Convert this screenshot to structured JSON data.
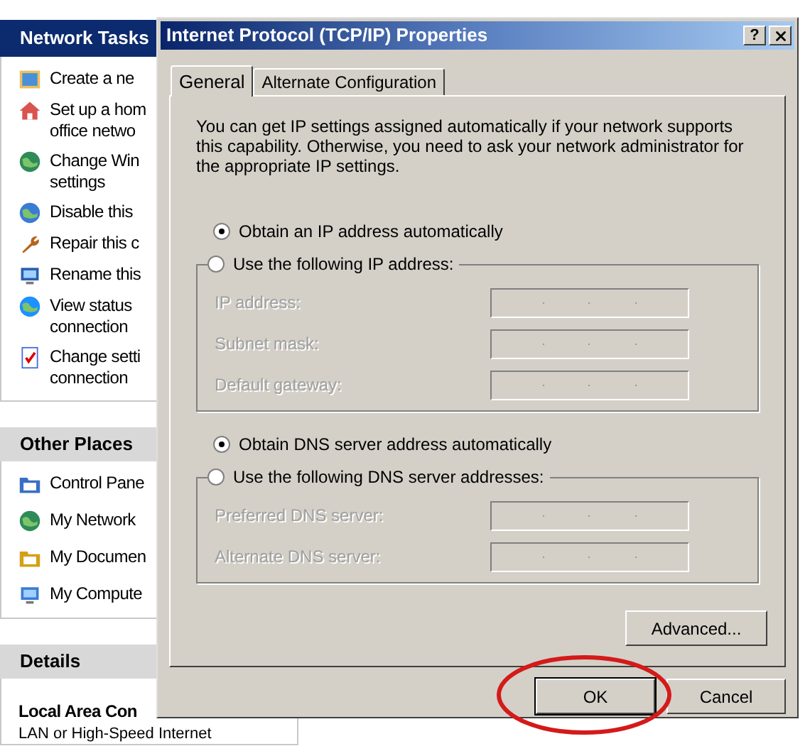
{
  "left_panel": {
    "sections": [
      {
        "title": "Network Tasks",
        "kind": "primary",
        "items": [
          {
            "lines": [
              "Create a ne"
            ]
          },
          {
            "lines": [
              "Set up a hom",
              "office netwo"
            ]
          },
          {
            "lines": [
              "Change Win",
              "settings"
            ]
          },
          {
            "lines": [
              "Disable this"
            ]
          },
          {
            "lines": [
              "Repair this c"
            ]
          },
          {
            "lines": [
              "Rename this"
            ]
          },
          {
            "lines": [
              "View status",
              "connection"
            ]
          },
          {
            "lines": [
              "Change setti",
              "connection"
            ]
          }
        ]
      },
      {
        "title": "Other Places",
        "kind": "secondary",
        "items": [
          {
            "lines": [
              "Control Pane"
            ]
          },
          {
            "lines": [
              "My Network"
            ]
          },
          {
            "lines": [
              "My Documen"
            ]
          },
          {
            "lines": [
              "My Compute"
            ]
          }
        ]
      },
      {
        "title": "Details",
        "kind": "secondary",
        "detail_title": "Local Area Con",
        "detail_text": "LAN or High-Speed Internet"
      }
    ]
  },
  "dialog": {
    "title": "Internet Protocol (TCP/IP) Properties",
    "help_button": "?",
    "tabs": [
      {
        "label": "General",
        "selected": true
      },
      {
        "label": "Alternate Configuration",
        "selected": false
      }
    ],
    "description": "You can get IP settings assigned automatically if your network supports this capability. Otherwise, you need to ask your network administrator for the appropriate IP settings.",
    "ip_options": [
      {
        "label": "Obtain an IP address automatically",
        "selected": true
      },
      {
        "label": "Use the following IP address:",
        "selected": false
      }
    ],
    "ip_fields": [
      {
        "label": "IP address:",
        "disabled": true
      },
      {
        "label": "Subnet mask:",
        "disabled": true
      },
      {
        "label": "Default gateway:",
        "disabled": true
      }
    ],
    "dns_options": [
      {
        "label": "Obtain DNS server address automatically",
        "selected": true
      },
      {
        "label": "Use the following DNS server addresses:",
        "selected": false
      }
    ],
    "dns_fields": [
      {
        "label": "Preferred DNS server:",
        "disabled": true
      },
      {
        "label": "Alternate DNS server:",
        "disabled": true
      }
    ],
    "advanced_button": "Advanced...",
    "buttons": [
      {
        "label": "OK",
        "highlighted": true
      },
      {
        "label": "Cancel",
        "highlighted": false
      }
    ]
  }
}
